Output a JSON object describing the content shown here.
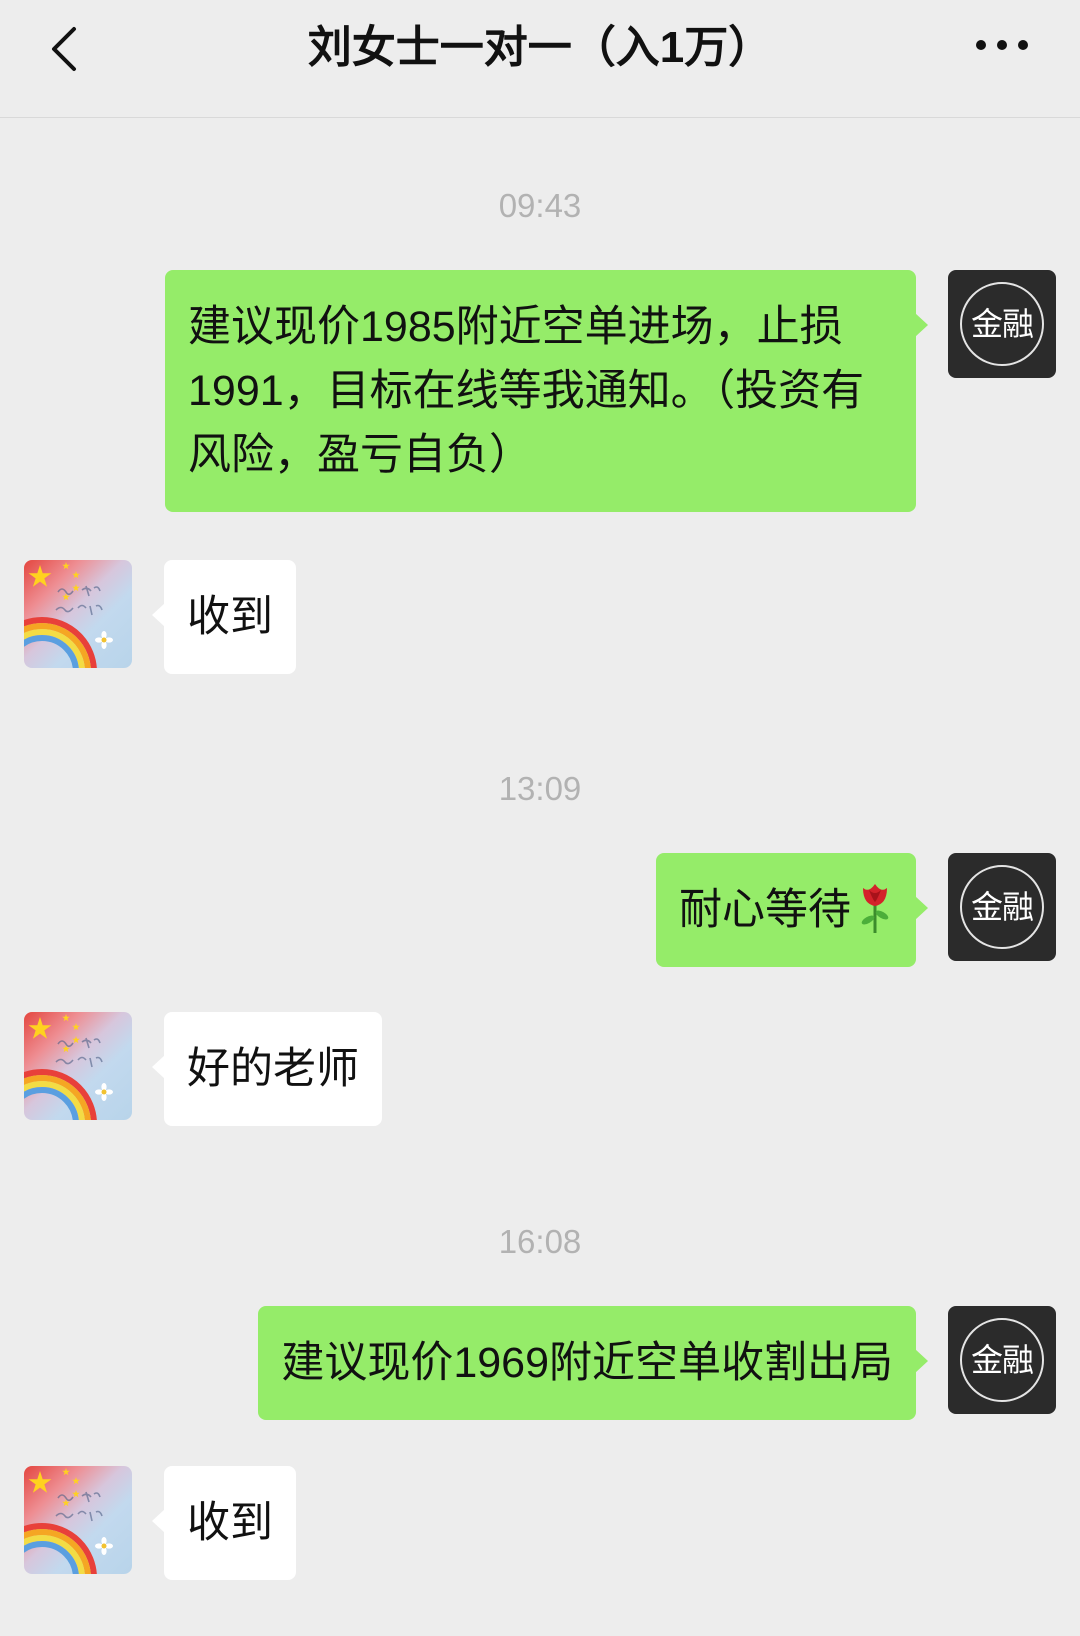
{
  "header": {
    "title": "刘女士一对一（入1万）",
    "back_icon": "chevron-left-icon",
    "more_icon": "more-dots-icon"
  },
  "colors": {
    "background": "#ededed",
    "sent_bubble": "#95ec69",
    "received_bubble": "#ffffff",
    "timestamp": "#b2b2b2",
    "self_avatar_bg": "#2b2b2b"
  },
  "avatars": {
    "self": {
      "text": "金融",
      "icon": "logo-circle-avatar"
    },
    "contact": {
      "icon": "flag-rainbow-avatar"
    }
  },
  "messages": [
    {
      "type": "time",
      "text": "09:43"
    },
    {
      "type": "sent",
      "text": "建议现价1985附近空单进场，止损1991，目标在线等我通知。（投资有风险，盈亏自负）"
    },
    {
      "type": "received",
      "text": "收到"
    },
    {
      "type": "time",
      "text": "13:09"
    },
    {
      "type": "sent",
      "text": "耐心等待",
      "emoji_icon": "rose-icon"
    },
    {
      "type": "received",
      "text": "好的老师"
    },
    {
      "type": "time",
      "text": "16:08"
    },
    {
      "type": "sent",
      "text": "建议现价1969附近空单收割出局"
    },
    {
      "type": "received",
      "text": "收到"
    }
  ]
}
